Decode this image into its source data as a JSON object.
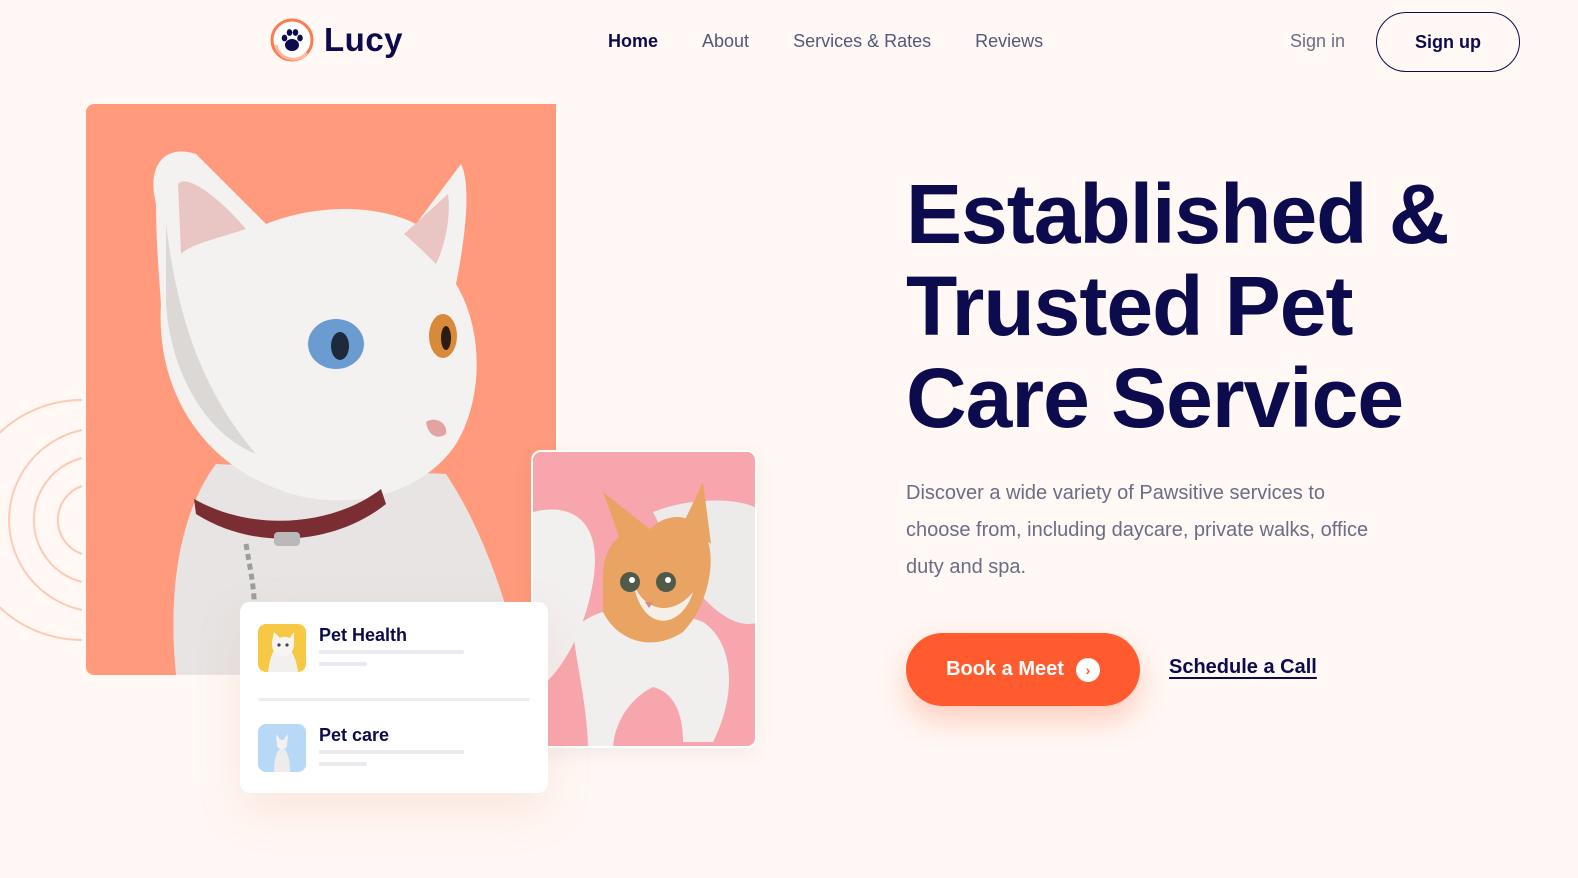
{
  "brand": {
    "name": "Lucy",
    "accent": "#ff5b2e",
    "navy": "#0b0b4d"
  },
  "nav": {
    "items": [
      {
        "label": "Home",
        "active": true
      },
      {
        "label": "About",
        "active": false
      },
      {
        "label": "Services & Rates",
        "active": false
      },
      {
        "label": "Reviews",
        "active": false
      }
    ],
    "signin_label": "Sign in",
    "signup_label": "Sign up"
  },
  "hero": {
    "headline": "Established & Trusted Pet Care Service",
    "description": "Discover a wide variety of Pawsitive services to choose from, including daycare, private walks, office duty and spa.",
    "cta_label": "Book a Meet",
    "cta_icon": "chevron-right-icon",
    "secondary_link": "Schedule a Call"
  },
  "card": {
    "items": [
      {
        "title": "Pet Health",
        "thumb_color": "#f6c843"
      },
      {
        "title": "Pet care",
        "thumb_color": "#b7d8f7"
      }
    ]
  },
  "colors": {
    "main_photo_bg": "#ff9b7c",
    "side_photo_bg": "#f7a6ad",
    "page_bg": "#fff8f4"
  }
}
